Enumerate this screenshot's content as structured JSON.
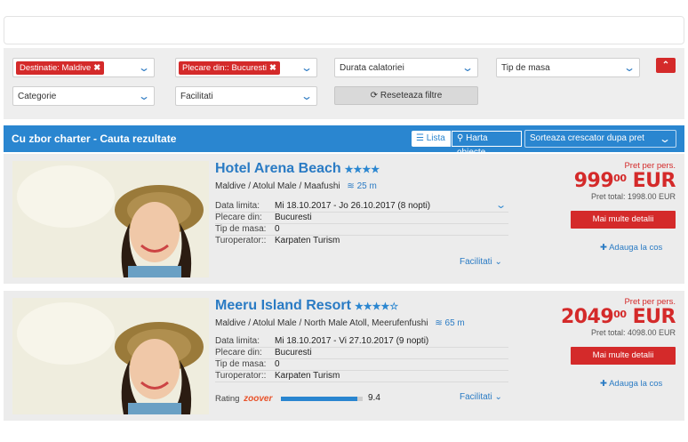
{
  "filters": {
    "destinatie_tag": "Destinatie: Maldive",
    "plecare_tag": "Plecare din:: Bucuresti",
    "durata_placeholder": "Durata calatoriei",
    "tip_masa_placeholder": "Tip de masa",
    "categorie_placeholder": "Categorie",
    "facilitati_placeholder": "Facilitati",
    "reset_label": "Reseteaza filtre"
  },
  "results_bar": {
    "title": "Cu zbor charter - Cauta rezultate",
    "view_list": "Lista",
    "view_map": "Harta obiecte",
    "sort_label": "Sorteaza crescator dupa pret"
  },
  "labels": {
    "data_limita": "Data limita:",
    "plecare_din": "Plecare din:",
    "tip_masa": "Tip de masa:",
    "turoperator": "Turoperator::",
    "facilitati": "Facilitati",
    "price_per_pers": "Pret per pers.",
    "details_button": "Mai multe detalii",
    "add_cart": "Adauga la cos",
    "rating": "Rating",
    "zoover": "zoover"
  },
  "colors": {
    "accent_blue": "#2a86d0",
    "accent_red": "#d42a2a"
  },
  "hotels": [
    {
      "name": "Hotel Arena Beach",
      "stars": "★★★★",
      "location": "Maldive / Atolul Male / Maafushi",
      "distance": "25 m",
      "data_limita": "Mi 18.10.2017 - Jo 26.10.2017 (8 nopti)",
      "plecare_din": "Bucuresti",
      "tip_masa": "0",
      "turoperator": "Karpaten Turism",
      "price_main": "999",
      "price_cents": "00",
      "currency": "EUR",
      "price_total": "Pret total: 1998.00 EUR"
    },
    {
      "name": "Meeru Island Resort",
      "stars": "★★★★☆",
      "location": "Maldive / Atolul Male / North Male Atoll, Meerufenfushi",
      "distance": "65 m",
      "data_limita": "Mi 18.10.2017 - Vi 27.10.2017 (9 nopti)",
      "plecare_din": "Bucuresti",
      "tip_masa": "0",
      "turoperator": "Karpaten Turism",
      "price_main": "2049",
      "price_cents": "00",
      "currency": "EUR",
      "price_total": "Pret total: 4098.00 EUR",
      "rating_value": "9.4",
      "rating_fraction": 0.94
    }
  ]
}
